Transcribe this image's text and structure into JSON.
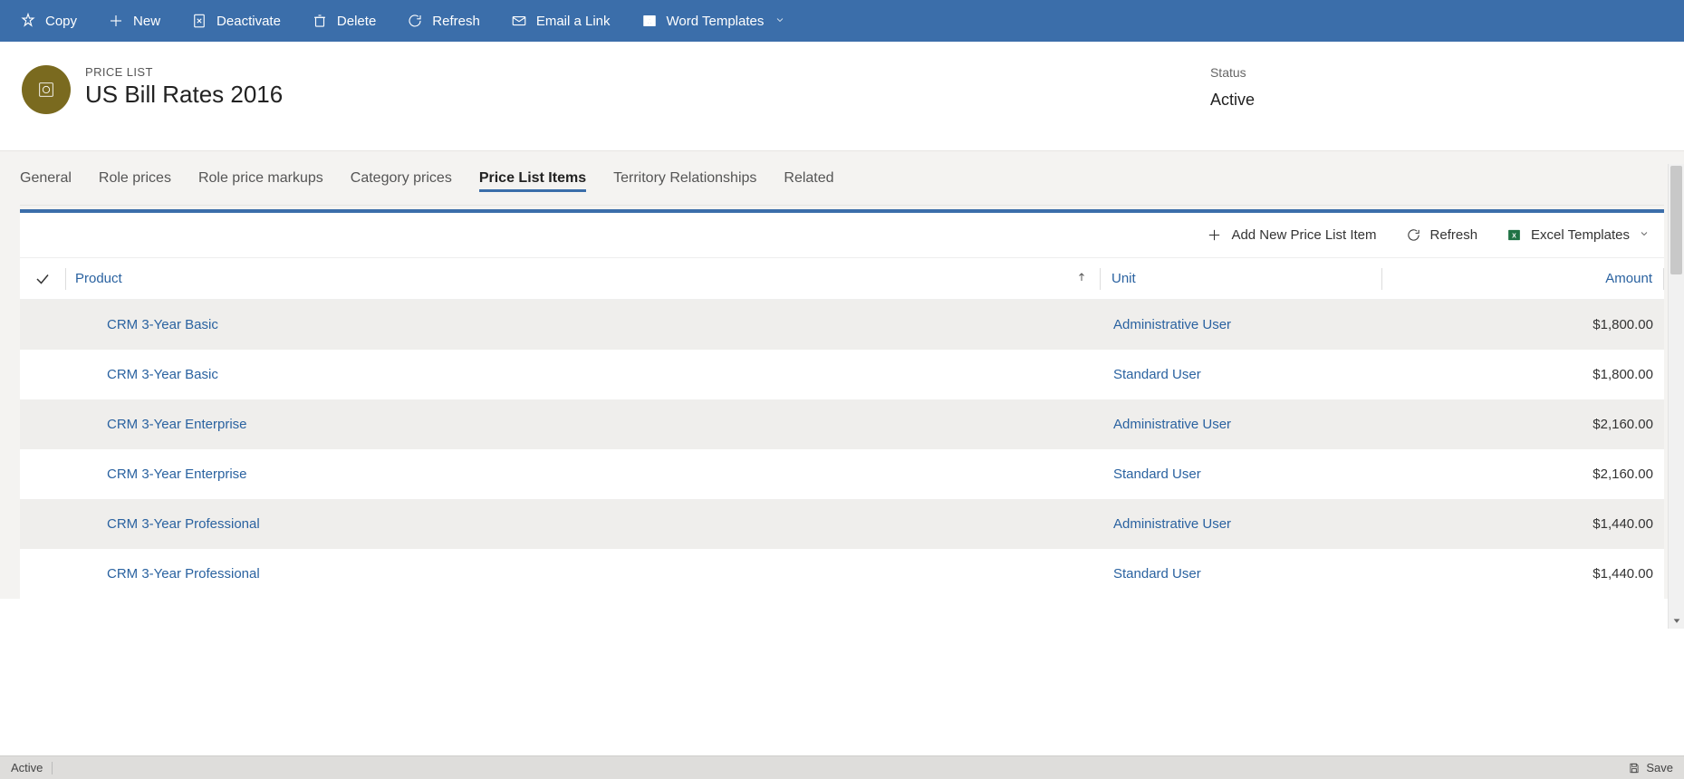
{
  "commands": {
    "copy": "Copy",
    "new": "New",
    "deactivate": "Deactivate",
    "delete": "Delete",
    "refresh": "Refresh",
    "email": "Email a Link",
    "word": "Word Templates"
  },
  "record": {
    "type_label": "PRICE LIST",
    "title": "US Bill Rates 2016"
  },
  "status": {
    "label": "Status",
    "value": "Active"
  },
  "tabs": [
    "General",
    "Role prices",
    "Role price markups",
    "Category prices",
    "Price List Items",
    "Territory Relationships",
    "Related"
  ],
  "active_tab_index": 4,
  "grid_toolbar": {
    "add": "Add New Price List Item",
    "refresh": "Refresh",
    "excel": "Excel Templates"
  },
  "columns": {
    "product": "Product",
    "unit": "Unit",
    "amount": "Amount"
  },
  "rows": [
    {
      "product": "CRM 3-Year Basic",
      "unit": "Administrative User",
      "amount": "$1,800.00"
    },
    {
      "product": "CRM 3-Year Basic",
      "unit": "Standard User",
      "amount": "$1,800.00"
    },
    {
      "product": "CRM 3-Year Enterprise",
      "unit": "Administrative User",
      "amount": "$2,160.00"
    },
    {
      "product": "CRM 3-Year Enterprise",
      "unit": "Standard User",
      "amount": "$2,160.00"
    },
    {
      "product": "CRM 3-Year Professional",
      "unit": "Administrative User",
      "amount": "$1,440.00"
    },
    {
      "product": "CRM 3-Year Professional",
      "unit": "Standard User",
      "amount": "$1,440.00"
    }
  ],
  "status_bar": {
    "state": "Active",
    "save": "Save"
  }
}
